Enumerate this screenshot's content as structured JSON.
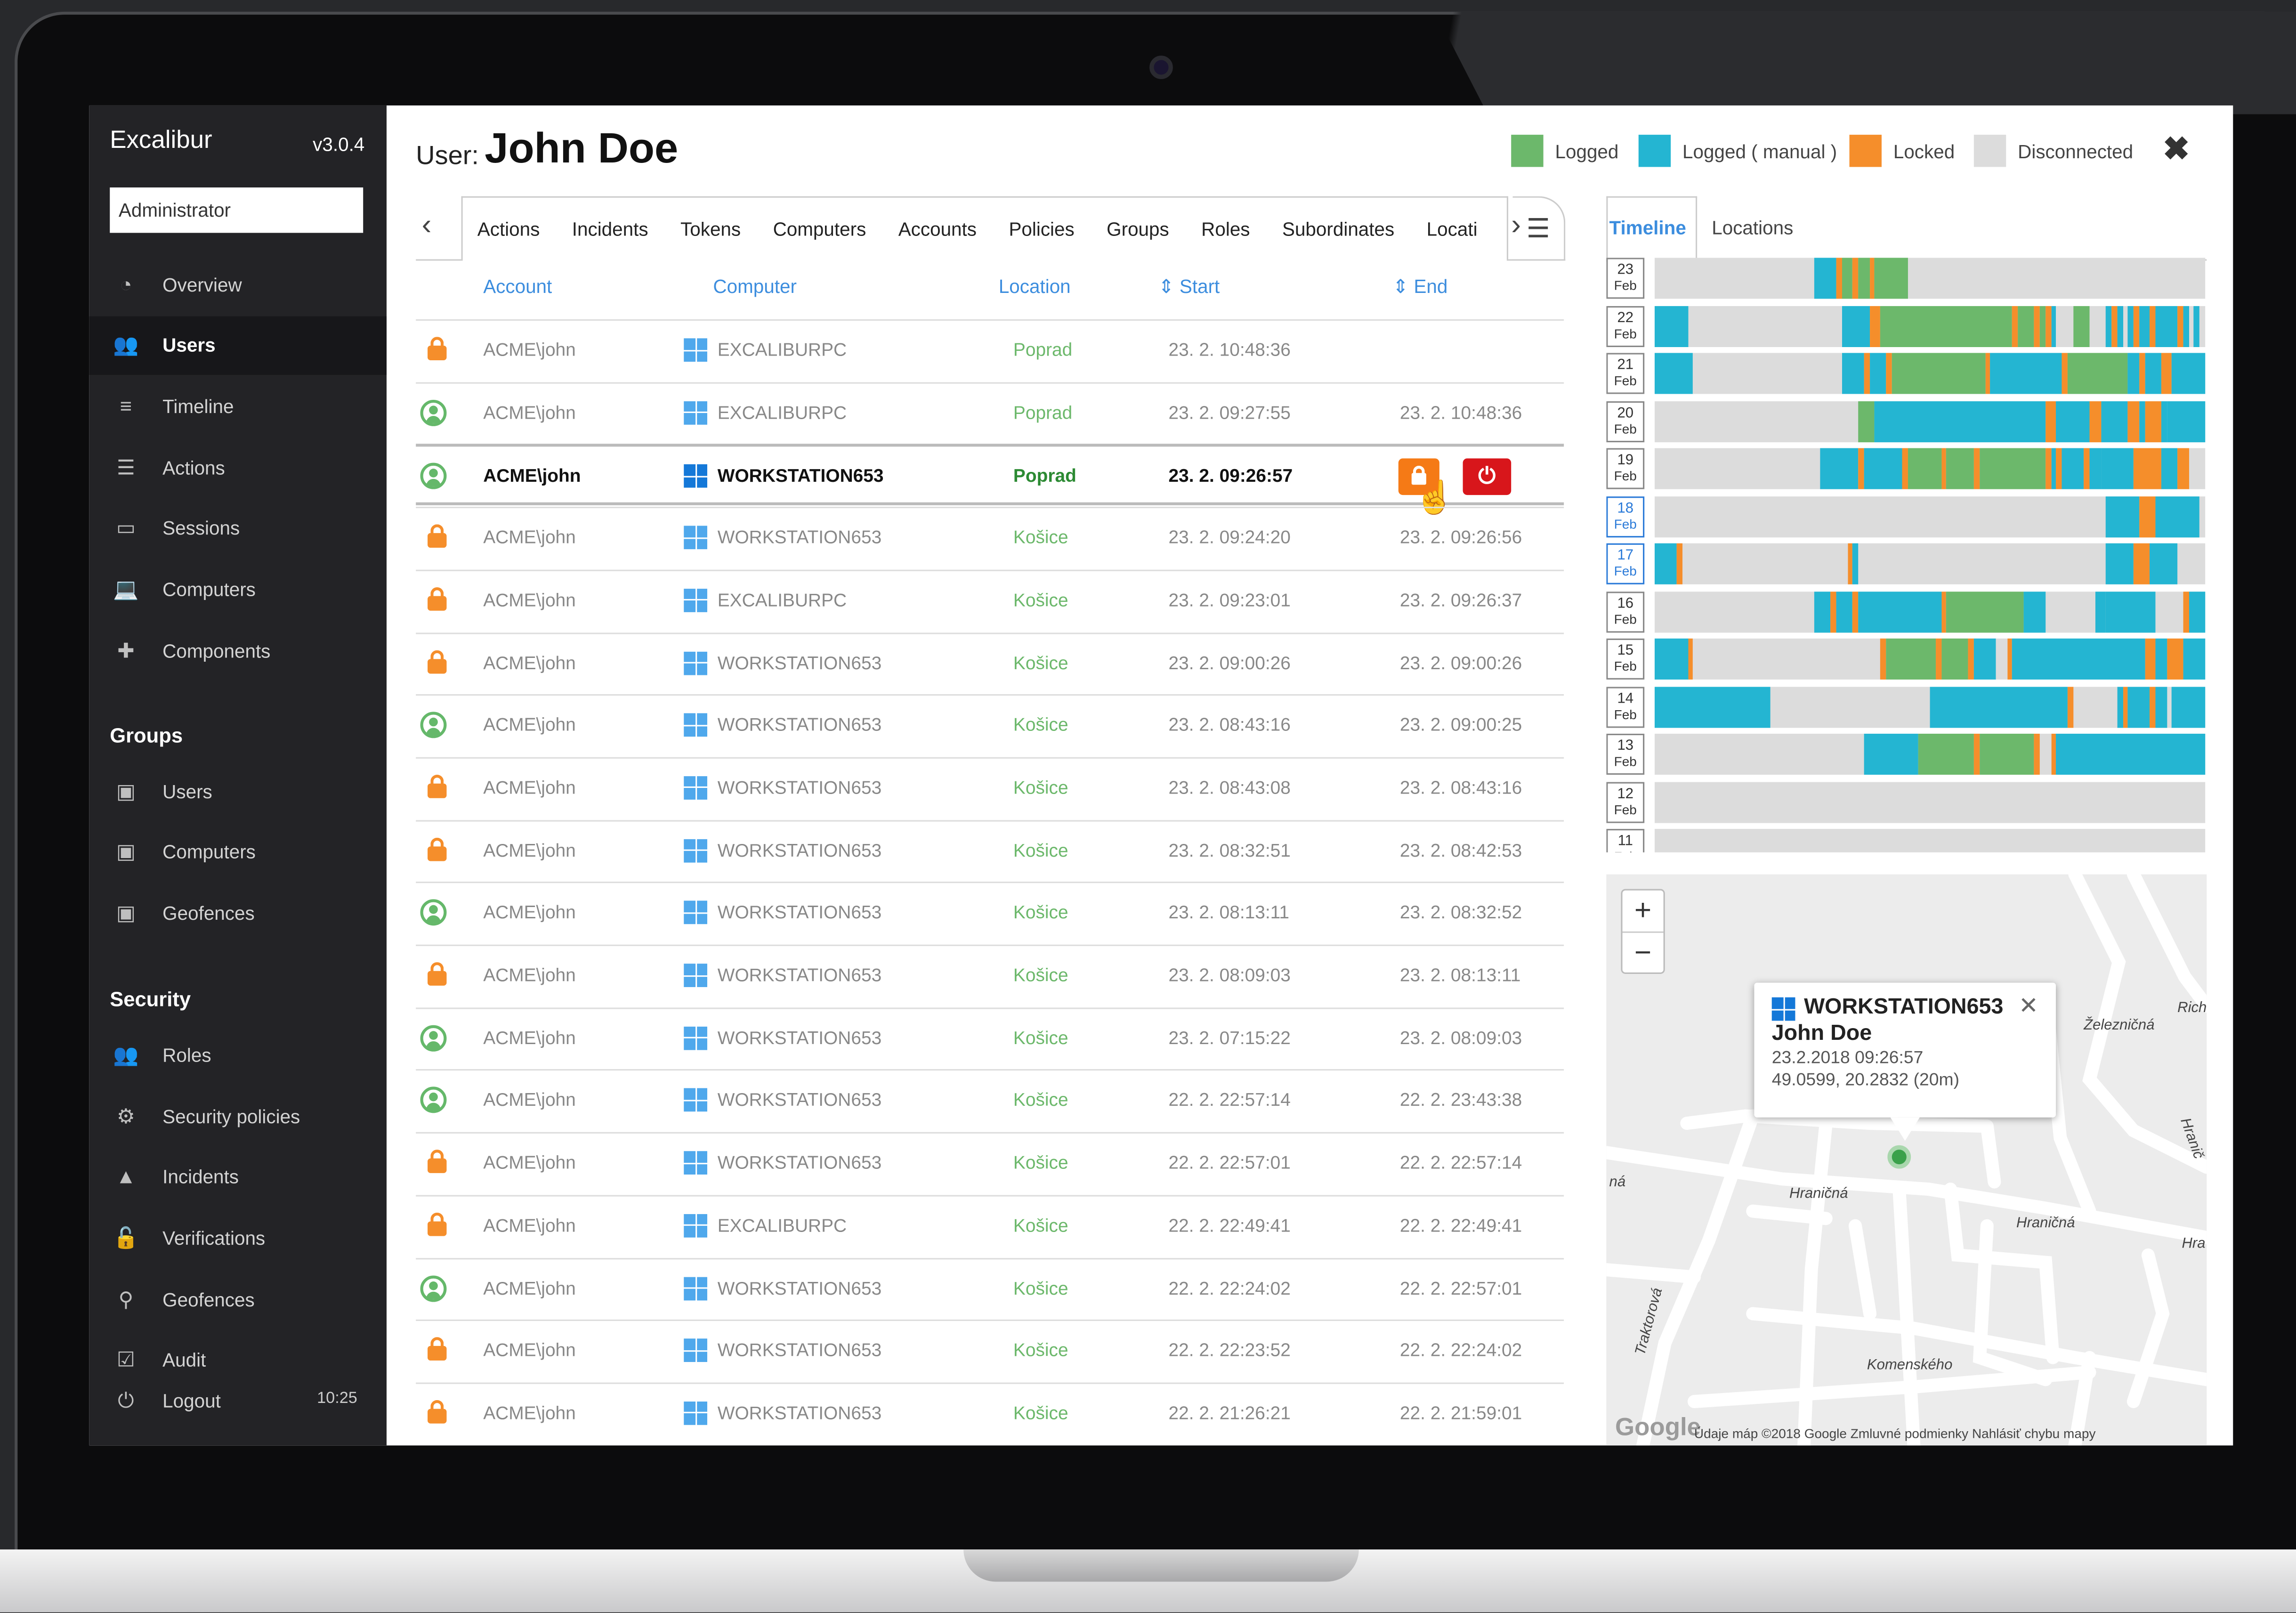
{
  "app": {
    "brand": "Excalibur",
    "version": "v3.0.4",
    "role": "Administrator",
    "clock": "10:25"
  },
  "nav": [
    {
      "label": "Overview",
      "icon": "pie-chart-icon"
    },
    {
      "label": "Users",
      "icon": "users-icon",
      "active": true
    },
    {
      "label": "Timeline",
      "icon": "timeline-icon"
    },
    {
      "label": "Actions",
      "icon": "list-icon"
    },
    {
      "label": "Sessions",
      "icon": "monitor-icon"
    },
    {
      "label": "Computers",
      "icon": "laptop-icon"
    },
    {
      "label": "Components",
      "icon": "puzzle-icon"
    }
  ],
  "groups": {
    "heading": "Groups",
    "items": [
      {
        "label": "Users",
        "icon": "group-box-icon"
      },
      {
        "label": "Computers",
        "icon": "group-box-icon"
      },
      {
        "label": "Geofences",
        "icon": "group-box-icon"
      }
    ]
  },
  "security": {
    "heading": "Security",
    "items": [
      {
        "label": "Roles",
        "icon": "roles-icon"
      },
      {
        "label": "Security policies",
        "icon": "cogs-icon"
      },
      {
        "label": "Incidents",
        "icon": "warning-icon"
      },
      {
        "label": "Verifications",
        "icon": "unlock-icon"
      },
      {
        "label": "Geofences",
        "icon": "map-pin-icon"
      },
      {
        "label": "Audit",
        "icon": "checkbox-icon"
      },
      {
        "label": "Logout",
        "icon": "power-icon"
      }
    ]
  },
  "header": {
    "label": "User:",
    "name": "John Doe",
    "legend": [
      {
        "label": "Logged",
        "color": "#6cb86b"
      },
      {
        "label": "Logged ( manual )",
        "color": "#24b5d2"
      },
      {
        "label": "Locked",
        "color": "#f58e2b"
      },
      {
        "label": "Disconnected",
        "color": "#dcdcdc"
      }
    ]
  },
  "tabs": [
    "Actions",
    "Incidents",
    "Tokens",
    "Computers",
    "Accounts",
    "Policies",
    "Groups",
    "Roles",
    "Subordinates",
    "Locati"
  ],
  "table": {
    "columns": {
      "account": "Account",
      "computer": "Computer",
      "location": "Location",
      "start": "Start",
      "end": "End"
    },
    "rows": [
      {
        "status": "locked",
        "account": "ACME\\john",
        "computer": "EXCALIBURPC",
        "location": "Poprad",
        "start": "23. 2. 10:48:36",
        "end": ""
      },
      {
        "status": "logged",
        "account": "ACME\\john",
        "computer": "EXCALIBURPC",
        "location": "Poprad",
        "start": "23. 2. 09:27:55",
        "end": "23. 2. 10:48:36"
      },
      {
        "status": "logged",
        "account": "ACME\\john",
        "computer": "WORKSTATION653",
        "location": "Poprad",
        "start": "23. 2. 09:26:57",
        "end": "",
        "selected": true
      },
      {
        "status": "locked",
        "account": "ACME\\john",
        "computer": "WORKSTATION653",
        "location": "Košice",
        "start": "23. 2. 09:24:20",
        "end": "23. 2. 09:26:56"
      },
      {
        "status": "locked",
        "account": "ACME\\john",
        "computer": "EXCALIBURPC",
        "location": "Košice",
        "start": "23. 2. 09:23:01",
        "end": "23. 2. 09:26:37"
      },
      {
        "status": "locked",
        "account": "ACME\\john",
        "computer": "WORKSTATION653",
        "location": "Košice",
        "start": "23. 2. 09:00:26",
        "end": "23. 2. 09:00:26"
      },
      {
        "status": "logged",
        "account": "ACME\\john",
        "computer": "WORKSTATION653",
        "location": "Košice",
        "start": "23. 2. 08:43:16",
        "end": "23. 2. 09:00:25"
      },
      {
        "status": "locked",
        "account": "ACME\\john",
        "computer": "WORKSTATION653",
        "location": "Košice",
        "start": "23. 2. 08:43:08",
        "end": "23. 2. 08:43:16"
      },
      {
        "status": "locked",
        "account": "ACME\\john",
        "computer": "WORKSTATION653",
        "location": "Košice",
        "start": "23. 2. 08:32:51",
        "end": "23. 2. 08:42:53"
      },
      {
        "status": "logged",
        "account": "ACME\\john",
        "computer": "WORKSTATION653",
        "location": "Košice",
        "start": "23. 2. 08:13:11",
        "end": "23. 2. 08:32:52"
      },
      {
        "status": "locked",
        "account": "ACME\\john",
        "computer": "WORKSTATION653",
        "location": "Košice",
        "start": "23. 2. 08:09:03",
        "end": "23. 2. 08:13:11"
      },
      {
        "status": "logged",
        "account": "ACME\\john",
        "computer": "WORKSTATION653",
        "location": "Košice",
        "start": "23. 2. 07:15:22",
        "end": "23. 2. 08:09:03"
      },
      {
        "status": "logged",
        "account": "ACME\\john",
        "computer": "WORKSTATION653",
        "location": "Košice",
        "start": "22. 2. 22:57:14",
        "end": "22. 2. 23:43:38"
      },
      {
        "status": "locked",
        "account": "ACME\\john",
        "computer": "WORKSTATION653",
        "location": "Košice",
        "start": "22. 2. 22:57:01",
        "end": "22. 2. 22:57:14"
      },
      {
        "status": "locked",
        "account": "ACME\\john",
        "computer": "EXCALIBURPC",
        "location": "Košice",
        "start": "22. 2. 22:49:41",
        "end": "22. 2. 22:49:41"
      },
      {
        "status": "logged",
        "account": "ACME\\john",
        "computer": "WORKSTATION653",
        "location": "Košice",
        "start": "22. 2. 22:24:02",
        "end": "22. 2. 22:57:01"
      },
      {
        "status": "locked",
        "account": "ACME\\john",
        "computer": "WORKSTATION653",
        "location": "Košice",
        "start": "22. 2. 22:23:52",
        "end": "22. 2. 22:24:02"
      },
      {
        "status": "locked",
        "account": "ACME\\john",
        "computer": "WORKSTATION653",
        "location": "Košice",
        "start": "22. 2. 21:26:21",
        "end": "22. 2. 21:59:01"
      }
    ]
  },
  "right_tabs": {
    "timeline": "Timeline",
    "locations": "Locations"
  },
  "timeline": {
    "days": [
      {
        "day": "23",
        "month": "Feb",
        "segments": [
          [
            0.29,
            0.33,
            "m"
          ],
          [
            0.33,
            0.34,
            "o"
          ],
          [
            0.34,
            0.36,
            "g"
          ],
          [
            0.36,
            0.37,
            "o"
          ],
          [
            0.37,
            0.39,
            "g"
          ],
          [
            0.39,
            0.4,
            "o"
          ],
          [
            0.4,
            0.46,
            "g"
          ]
        ]
      },
      {
        "day": "22",
        "month": "Feb",
        "segments": [
          [
            0.0,
            0.06,
            "m"
          ],
          [
            0.34,
            0.39,
            "m"
          ],
          [
            0.39,
            0.41,
            "o"
          ],
          [
            0.41,
            0.65,
            "g"
          ],
          [
            0.65,
            0.66,
            "o"
          ],
          [
            0.66,
            0.69,
            "g"
          ],
          [
            0.69,
            0.7,
            "o"
          ],
          [
            0.7,
            0.71,
            "g"
          ],
          [
            0.71,
            0.72,
            "o"
          ],
          [
            0.72,
            0.73,
            "m"
          ],
          [
            0.76,
            0.79,
            "g"
          ],
          [
            0.82,
            0.83,
            "m"
          ],
          [
            0.83,
            0.84,
            "o"
          ],
          [
            0.84,
            0.85,
            "m"
          ],
          [
            0.86,
            0.87,
            "m"
          ],
          [
            0.87,
            0.88,
            "o"
          ],
          [
            0.88,
            0.9,
            "m"
          ],
          [
            0.9,
            0.91,
            "o"
          ],
          [
            0.91,
            0.95,
            "m"
          ],
          [
            0.95,
            0.96,
            "o"
          ],
          [
            0.96,
            0.97,
            "m"
          ],
          [
            0.98,
            0.99,
            "m"
          ]
        ]
      },
      {
        "day": "21",
        "month": "Feb",
        "segments": [
          [
            0.0,
            0.07,
            "m"
          ],
          [
            0.34,
            0.38,
            "m"
          ],
          [
            0.38,
            0.39,
            "o"
          ],
          [
            0.39,
            0.42,
            "m"
          ],
          [
            0.42,
            0.43,
            "o"
          ],
          [
            0.43,
            0.6,
            "g"
          ],
          [
            0.6,
            0.61,
            "o"
          ],
          [
            0.61,
            0.74,
            "m"
          ],
          [
            0.74,
            0.75,
            "o"
          ],
          [
            0.75,
            0.86,
            "g"
          ],
          [
            0.86,
            0.88,
            "m"
          ],
          [
            0.88,
            0.89,
            "o"
          ],
          [
            0.89,
            0.92,
            "m"
          ],
          [
            0.92,
            0.94,
            "o"
          ],
          [
            0.94,
            1.0,
            "m"
          ]
        ]
      },
      {
        "day": "20",
        "month": "Feb",
        "segments": [
          [
            0.37,
            0.4,
            "g"
          ],
          [
            0.4,
            0.71,
            "m"
          ],
          [
            0.71,
            0.73,
            "o"
          ],
          [
            0.73,
            0.79,
            "m"
          ],
          [
            0.79,
            0.81,
            "o"
          ],
          [
            0.81,
            0.86,
            "m"
          ],
          [
            0.86,
            0.88,
            "o"
          ],
          [
            0.88,
            0.89,
            "m"
          ],
          [
            0.89,
            0.92,
            "o"
          ],
          [
            0.92,
            0.93,
            "m"
          ],
          [
            0.93,
            1.0,
            "m"
          ]
        ]
      },
      {
        "day": "19",
        "month": "Feb",
        "segments": [
          [
            0.3,
            0.37,
            "m"
          ],
          [
            0.37,
            0.38,
            "o"
          ],
          [
            0.38,
            0.45,
            "m"
          ],
          [
            0.45,
            0.46,
            "o"
          ],
          [
            0.46,
            0.52,
            "g"
          ],
          [
            0.52,
            0.53,
            "o"
          ],
          [
            0.53,
            0.58,
            "g"
          ],
          [
            0.58,
            0.59,
            "o"
          ],
          [
            0.59,
            0.71,
            "g"
          ],
          [
            0.71,
            0.72,
            "o"
          ],
          [
            0.72,
            0.73,
            "m"
          ],
          [
            0.73,
            0.74,
            "o"
          ],
          [
            0.74,
            0.78,
            "m"
          ],
          [
            0.78,
            0.79,
            "o"
          ],
          [
            0.79,
            0.81,
            "m"
          ],
          [
            0.81,
            0.87,
            "m"
          ],
          [
            0.87,
            0.92,
            "o"
          ],
          [
            0.92,
            0.95,
            "m"
          ],
          [
            0.95,
            0.97,
            "o"
          ]
        ]
      },
      {
        "day": "18",
        "month": "Feb",
        "segments": [
          [
            0.82,
            0.88,
            "m"
          ],
          [
            0.88,
            0.91,
            "o"
          ],
          [
            0.91,
            0.99,
            "m"
          ]
        ]
      },
      {
        "day": "17",
        "month": "Feb",
        "segments": [
          [
            0.0,
            0.04,
            "m"
          ],
          [
            0.04,
            0.05,
            "o"
          ],
          [
            0.35,
            0.36,
            "o"
          ],
          [
            0.36,
            0.37,
            "m"
          ],
          [
            0.82,
            0.87,
            "m"
          ],
          [
            0.87,
            0.9,
            "o"
          ],
          [
            0.9,
            0.95,
            "m"
          ]
        ]
      },
      {
        "day": "16",
        "month": "Feb",
        "segments": [
          [
            0.29,
            0.32,
            "m"
          ],
          [
            0.32,
            0.33,
            "o"
          ],
          [
            0.33,
            0.36,
            "m"
          ],
          [
            0.36,
            0.37,
            "o"
          ],
          [
            0.37,
            0.52,
            "m"
          ],
          [
            0.52,
            0.53,
            "o"
          ],
          [
            0.53,
            0.67,
            "g"
          ],
          [
            0.67,
            0.71,
            "m"
          ],
          [
            0.8,
            0.82,
            "m"
          ],
          [
            0.82,
            0.91,
            "m"
          ],
          [
            0.96,
            0.97,
            "o"
          ],
          [
            0.97,
            1.0,
            "m"
          ]
        ]
      },
      {
        "day": "15",
        "month": "Feb",
        "segments": [
          [
            0.0,
            0.06,
            "m"
          ],
          [
            0.06,
            0.07,
            "o"
          ],
          [
            0.41,
            0.42,
            "o"
          ],
          [
            0.42,
            0.51,
            "g"
          ],
          [
            0.51,
            0.52,
            "o"
          ],
          [
            0.52,
            0.57,
            "g"
          ],
          [
            0.57,
            0.58,
            "o"
          ],
          [
            0.58,
            0.62,
            "m"
          ],
          [
            0.64,
            0.65,
            "o"
          ],
          [
            0.65,
            0.89,
            "m"
          ],
          [
            0.89,
            0.91,
            "o"
          ],
          [
            0.91,
            0.93,
            "m"
          ],
          [
            0.93,
            0.96,
            "o"
          ],
          [
            0.96,
            1.0,
            "m"
          ]
        ]
      },
      {
        "day": "14",
        "month": "Feb",
        "segments": [
          [
            0.0,
            0.21,
            "m"
          ],
          [
            0.5,
            0.75,
            "m"
          ],
          [
            0.75,
            0.76,
            "o"
          ],
          [
            0.84,
            0.85,
            "m"
          ],
          [
            0.85,
            0.86,
            "o"
          ],
          [
            0.86,
            0.9,
            "m"
          ],
          [
            0.9,
            0.91,
            "o"
          ],
          [
            0.91,
            0.93,
            "m"
          ],
          [
            0.94,
            1.0,
            "m"
          ]
        ]
      },
      {
        "day": "13",
        "month": "Feb",
        "segments": [
          [
            0.38,
            0.48,
            "m"
          ],
          [
            0.48,
            0.58,
            "g"
          ],
          [
            0.58,
            0.59,
            "o"
          ],
          [
            0.59,
            0.69,
            "g"
          ],
          [
            0.69,
            0.7,
            "o"
          ],
          [
            0.72,
            0.73,
            "o"
          ],
          [
            0.73,
            1.0,
            "m"
          ]
        ]
      },
      {
        "day": "12",
        "month": "Feb",
        "segments": []
      },
      {
        "day": "11",
        "month": "Feb",
        "segments": []
      }
    ]
  },
  "map": {
    "popup": {
      "computer": "WORKSTATION653",
      "user": "John Doe",
      "time": "23.2.2018 09:26:57",
      "coords": "49.0599, 20.2832 (20m)"
    },
    "streets": [
      "Železničná",
      "Hraničná",
      "Hraničná",
      "Komenského",
      "Traktorová",
      "Rich",
      "Hra",
      "Hranič",
      "ná"
    ],
    "footer": "Údaje máp ©2018 Google   Zmluvné podmienky   Nahlásiť chybu mapy",
    "logo": "Google",
    "zoom_in": "+",
    "zoom_out": "−"
  }
}
